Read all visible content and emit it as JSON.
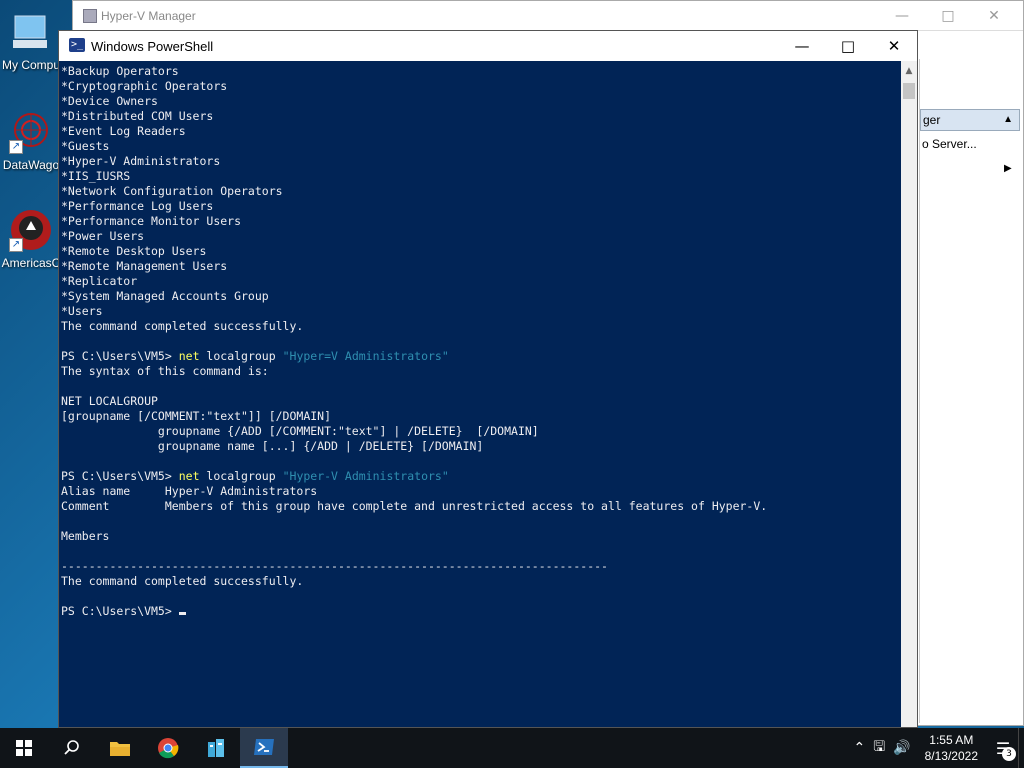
{
  "desktop": {
    "icons": [
      {
        "label": "My Compu"
      },
      {
        "label": "DataWago"
      },
      {
        "label": "AmericasC"
      }
    ]
  },
  "hyperv": {
    "title": "Hyper-V Manager",
    "actions_header": "ger",
    "action_item": "o Server..."
  },
  "powershell": {
    "title": "Windows PowerShell",
    "prompt": "PS C:\\Users\\VM5>",
    "groups": [
      "*Backup Operators",
      "*Cryptographic Operators",
      "*Device Owners",
      "*Distributed COM Users",
      "*Event Log Readers",
      "*Guests",
      "*Hyper-V Administrators",
      "*IIS_IUSRS",
      "*Network Configuration Operators",
      "*Performance Log Users",
      "*Performance Monitor Users",
      "*Power Users",
      "*Remote Desktop Users",
      "*Remote Management Users",
      "*Replicator",
      "*System Managed Accounts Group",
      "*Users"
    ],
    "completed": "The command completed successfully.",
    "cmd1_kw": "net",
    "cmd1_rest": " localgroup ",
    "cmd1_arg": "\"Hyper=V Administrators\"",
    "syntax_lines": [
      "The syntax of this command is:",
      "",
      "NET LOCALGROUP",
      "[groupname [/COMMENT:\"text\"]] [/DOMAIN]",
      "              groupname {/ADD [/COMMENT:\"text\"] | /DELETE}  [/DOMAIN]",
      "              groupname name [...] {/ADD | /DELETE} [/DOMAIN]"
    ],
    "cmd2_kw": "net",
    "cmd2_rest": " localgroup ",
    "cmd2_arg": "\"Hyper-V Administrators\"",
    "alias_line": "Alias name     Hyper-V Administrators",
    "comment_line": "Comment        Members of this group have complete and unrestricted access to all features of Hyper-V.",
    "members_label": "Members",
    "separator": "-------------------------------------------------------------------------------"
  },
  "taskbar": {
    "time": "1:55 AM",
    "date": "8/13/2022",
    "notification_count": "3"
  }
}
